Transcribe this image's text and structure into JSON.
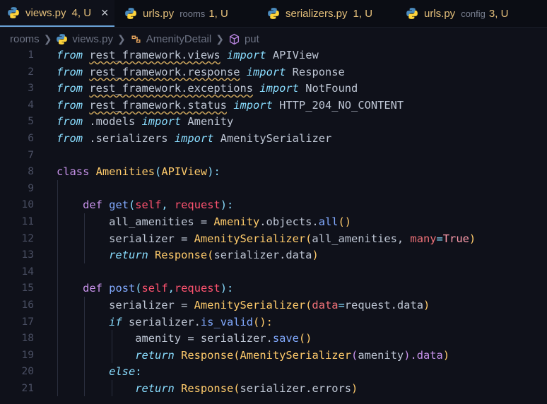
{
  "tabs": [
    {
      "file": "views.py",
      "extra": "4, U",
      "close": "×",
      "active": true
    },
    {
      "file": "urls.py",
      "folder": "rooms",
      "extra": "1, U",
      "active": false
    },
    {
      "file": "serializers.py",
      "extra": "1, U",
      "active": false
    },
    {
      "file": "urls.py",
      "folder": "config",
      "extra": "3, U",
      "active": false
    }
  ],
  "breadcrumb": {
    "folder": "rooms",
    "file": "views.py",
    "class": "AmenityDetail",
    "method": "put"
  },
  "line_numbers": [
    "1",
    "2",
    "3",
    "4",
    "5",
    "6",
    "7",
    "8",
    "9",
    "10",
    "11",
    "12",
    "13",
    "14",
    "15",
    "16",
    "17",
    "18",
    "19",
    "20",
    "21"
  ],
  "code": {
    "l1": [
      "from",
      "rest_framework.views",
      "import",
      "APIView"
    ],
    "l2": [
      "from",
      "rest_framework.response",
      "import",
      "Response"
    ],
    "l3": [
      "from",
      "rest_framework.exceptions",
      "import",
      "NotFound"
    ],
    "l4": [
      "from",
      "rest_framework.status",
      "import",
      "HTTP_204_NO_CONTENT"
    ],
    "l5": [
      "from",
      ".models",
      "import",
      "Amenity"
    ],
    "l6": [
      "from",
      ".serializers",
      "import",
      "AmenitySerializer"
    ],
    "l8": [
      "class",
      "Amenities",
      "(",
      "APIView",
      "):"
    ],
    "l10": [
      "def",
      "get",
      "(",
      "self",
      ", ",
      "request",
      "):"
    ],
    "l11": [
      "all_amenities = ",
      "Amenity",
      ".objects.",
      "all",
      "()"
    ],
    "l12": [
      "serializer = ",
      "AmenitySerializer",
      "(",
      "all_amenities, ",
      "many",
      "=",
      "True",
      ")"
    ],
    "l13": [
      "return",
      "Response",
      "(",
      "serializer.data",
      ")"
    ],
    "l15": [
      "def",
      "post",
      "(",
      "self",
      ",",
      "request",
      "):"
    ],
    "l16": [
      "serializer = ",
      "AmenitySerializer",
      "(",
      "data",
      "=",
      "request.data",
      ")"
    ],
    "l17": [
      "if",
      "serializer.",
      "is_valid",
      "():"
    ],
    "l18": [
      "amenity = ",
      "serializer.",
      "save",
      "()"
    ],
    "l19": [
      "return",
      "Response",
      "(",
      "AmenitySerializer",
      "(",
      "amenity",
      ").data",
      ")"
    ],
    "l20": [
      "else",
      ":"
    ],
    "l21": [
      "return",
      "Response",
      "(",
      "serializer.errors",
      ")"
    ]
  }
}
